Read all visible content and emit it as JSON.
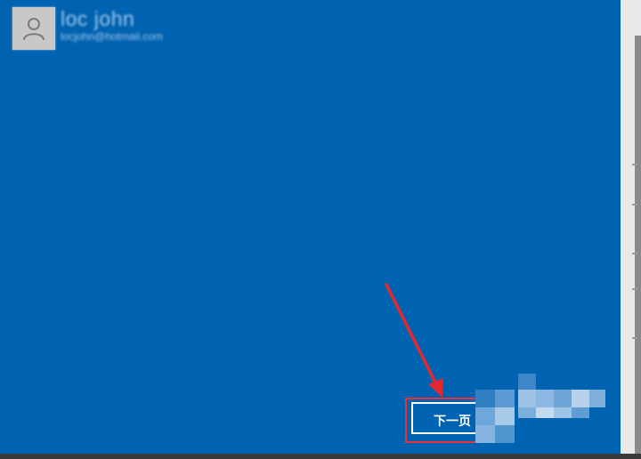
{
  "account": {
    "name": "loc john",
    "email": "locjohn@hotmail.com",
    "avatar_icon": "user-avatar-icon"
  },
  "footer": {
    "next_label": "下一页"
  },
  "colors": {
    "background": "#0063b1",
    "accent_border": "#ffffff",
    "annotation": "#e8262d"
  }
}
